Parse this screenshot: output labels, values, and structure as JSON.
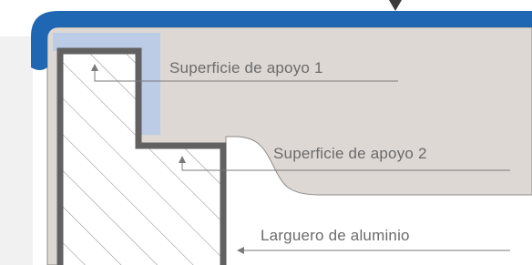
{
  "diagram": {
    "labels": {
      "support_surface_1": "Superficie de apoyo 1",
      "support_surface_2": "Superficie de apoyo 2",
      "aluminium_rail": "Larguero de aluminio"
    },
    "colors": {
      "background": "#ffffff",
      "panel": "#ddd8d4",
      "edge_trim": "#1f67b3",
      "support_highlight": "#bccbe6",
      "profile_stroke": "#616161",
      "hatch": "#8a8a8a",
      "leader": "#7a7a7a",
      "text": "#6b6b6b"
    }
  }
}
